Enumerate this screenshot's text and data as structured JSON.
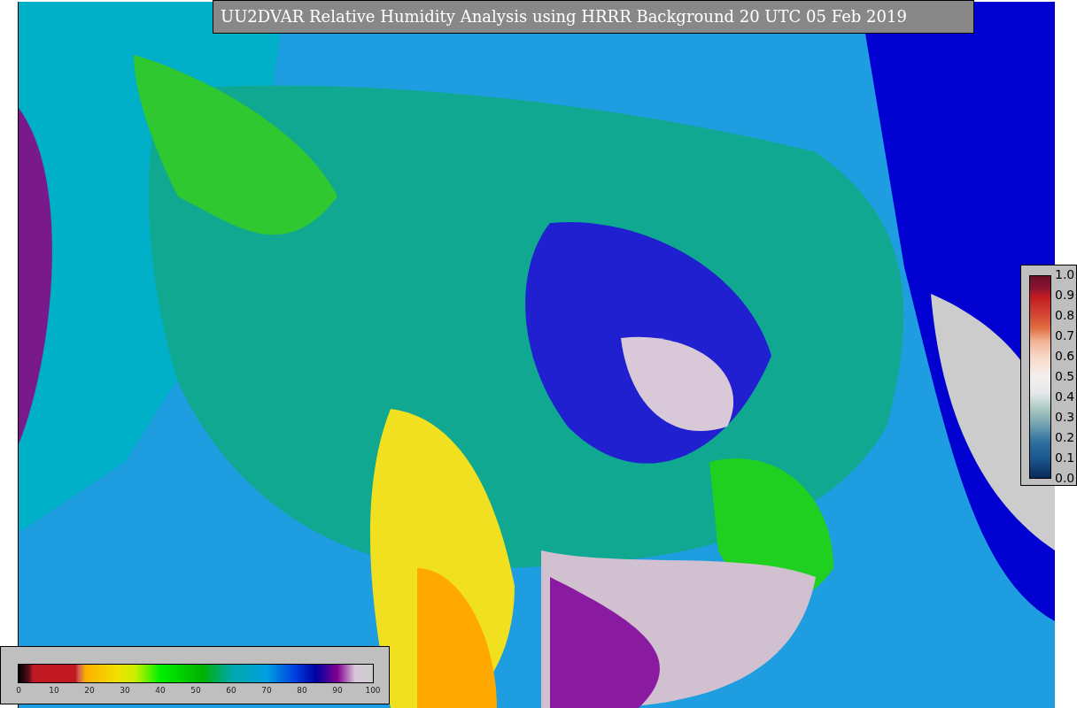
{
  "title": "UU2DVAR Relative Humidity Analysis using HRRR Background 20 UTC 05 Feb 2019",
  "station_colorbar": {
    "ticks": [
      "1.0",
      "0.9",
      "0.8",
      "0.7",
      "0.6",
      "0.5",
      "0.4",
      "0.3",
      "0.2",
      "0.1",
      "0.0"
    ]
  },
  "humidity_colorbar": {
    "ticks": [
      "0",
      "10",
      "20",
      "30",
      "40",
      "50",
      "60",
      "70",
      "80",
      "90",
      "100"
    ]
  }
}
